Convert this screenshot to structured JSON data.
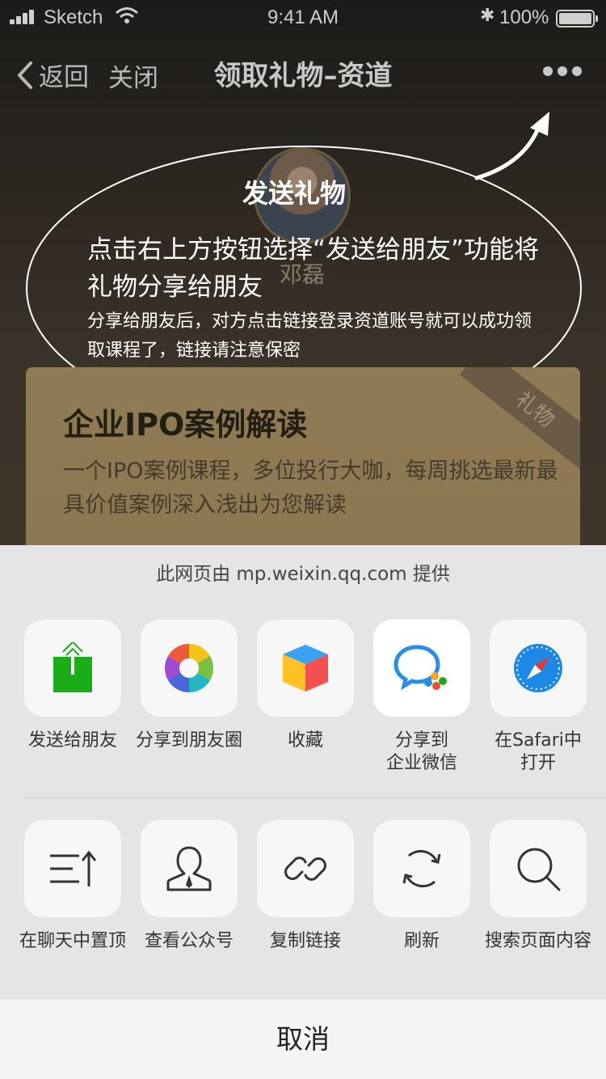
{
  "status_bar": {
    "carrier": "Sketch",
    "time": "9:41 AM",
    "battery": "100%"
  },
  "nav": {
    "back_label": "返回",
    "close_label": "关闭",
    "title": "领取礼物–资道"
  },
  "guide": {
    "title": "发送礼物",
    "main": "点击右上方按钮选择“发送给朋友”功能将礼物分享给朋友",
    "sub": "分享给朋友后，对方点击链接登录资道账号就可以成功领取课程了，链接请注意保密",
    "avatar_name": "邓磊"
  },
  "gift": {
    "ribbon": "礼物",
    "title": "企业IPO案例解读",
    "desc": "一个IPO案例课程，多位投行大咖，每周挑选最新最具价值案例深入浅出为您解读"
  },
  "sheet": {
    "source": "此网页由 mp.weixin.qq.com 提供",
    "row1": [
      {
        "label": "发送给朋友",
        "icon": "send-to-friend-icon"
      },
      {
        "label": "分享到朋友圈",
        "icon": "moments-icon"
      },
      {
        "label": "收藏",
        "icon": "favorite-cube-icon"
      },
      {
        "label": "分享到\n企业微信",
        "icon": "wework-icon"
      },
      {
        "label": "在Safari中\n打开",
        "icon": "safari-icon"
      }
    ],
    "row2": [
      {
        "label": "在聊天中置顶",
        "icon": "pin-to-top-icon"
      },
      {
        "label": "查看公众号",
        "icon": "official-account-icon"
      },
      {
        "label": "复制链接",
        "icon": "link-icon"
      },
      {
        "label": "刷新",
        "icon": "refresh-icon"
      },
      {
        "label": "搜索页面内容",
        "icon": "search-icon"
      }
    ],
    "cancel": "取消"
  },
  "colors": {
    "send_green": "#1aad19",
    "sheet_bg": "#e5e5e7",
    "card_gold": "#8e7a54"
  }
}
